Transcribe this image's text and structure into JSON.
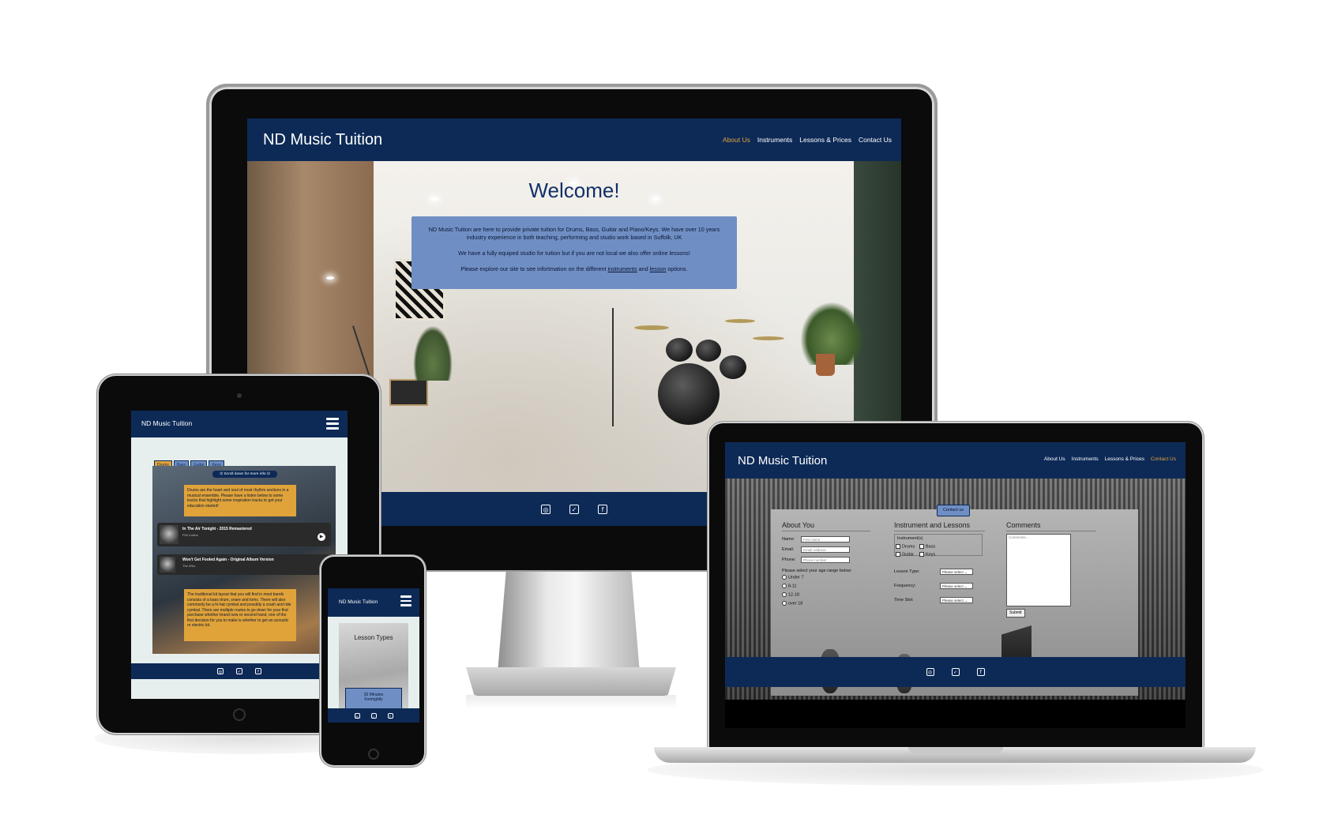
{
  "site": {
    "brand": "ND Music Tuition",
    "nav_desktop": [
      "About Us",
      "Instruments",
      "Lessons & Prices",
      "Contact Us"
    ],
    "footer_icons": [
      "instagram-icon",
      "twitter-icon",
      "facebook-icon"
    ]
  },
  "desktop": {
    "active_nav": "About Us",
    "heading": "Welcome!",
    "intro_p1": "ND Music Tuition are here to provide private tuition for Drums, Bass, Guitar and Piano/Keys. We have over 10 years industry experience in both teaching, performing and studio work based in Suffolk, UK",
    "intro_p2": "We have a fully equiped studio for tuition but if you are not local we also offer online lessons!",
    "intro_p3_before": "Please explore our site to see infortmation on the different",
    "intro_link_instruments": "instruments",
    "intro_and": "and",
    "intro_link_lesson": "lesson",
    "intro_p3_after": "options."
  },
  "tablet": {
    "brand": "ND Music Tuition",
    "tabs": [
      "Drums",
      "Bass",
      "Guitar",
      "Keys"
    ],
    "active_tab": "Drums",
    "scroll_hint": "Scroll down for more info",
    "note1": "Drums are the heart and soul of most rhythm sections in a musical ensemble. Please have a listen below to some tracks that highlight some inspiration tracks to get your education started!",
    "track1_title": "In The Air Tonight - 2015 Remastered",
    "track1_artist": "Phil Collins",
    "track2_title": "Won't Get Fooled Again - Original Album Version",
    "track2_artist": "The Who",
    "note2": "The traditional kit layout that you will find in most bands consists of a bass drum, snare and toms. There will also commonly be a hi-hat cymbal and possibly a crash and ride cymbal. There are multiple routes to go down for your first purchase whether brand new or second hand, one of the first decision for you to make is whether to get an acoustic or electric kit."
  },
  "phone": {
    "brand": "ND Music Tuition",
    "heading": "Lesson Types",
    "card_line1": "30 Minutes",
    "card_line2": "Fortnightly"
  },
  "laptop": {
    "brand": "ND Music Tuition",
    "active_nav": "Contact Us",
    "contact_tab": "Contact us",
    "about_title": "About You",
    "name_label": "Name:",
    "name_placeholder": "First name",
    "email_label": "Email:",
    "email_placeholder": "Email Address",
    "phone_label": "Phone:",
    "phone_placeholder": "Phone number",
    "age_prompt": "Please select your age range below:",
    "age_options": [
      "Under 7",
      "8-11",
      "12-18",
      "over 18"
    ],
    "lessons_title": "Instrument and Lessons",
    "instruments_legend": "Instrument(s)",
    "instrument_options": [
      "Drums",
      "Bass",
      "Guitar",
      "Keys"
    ],
    "lesson_type_label": "Lesson Type:",
    "frequency_label": "Frequency:",
    "time_slot_label": "Time Slot:",
    "select_placeholder": "Please select",
    "comments_title": "Comments",
    "comments_placeholder": "Comments...",
    "submit_label": "Submit"
  },
  "colors": {
    "navy": "#0d2a57",
    "accent": "#e0a33a",
    "panel_blue": "#6f8fc4"
  }
}
